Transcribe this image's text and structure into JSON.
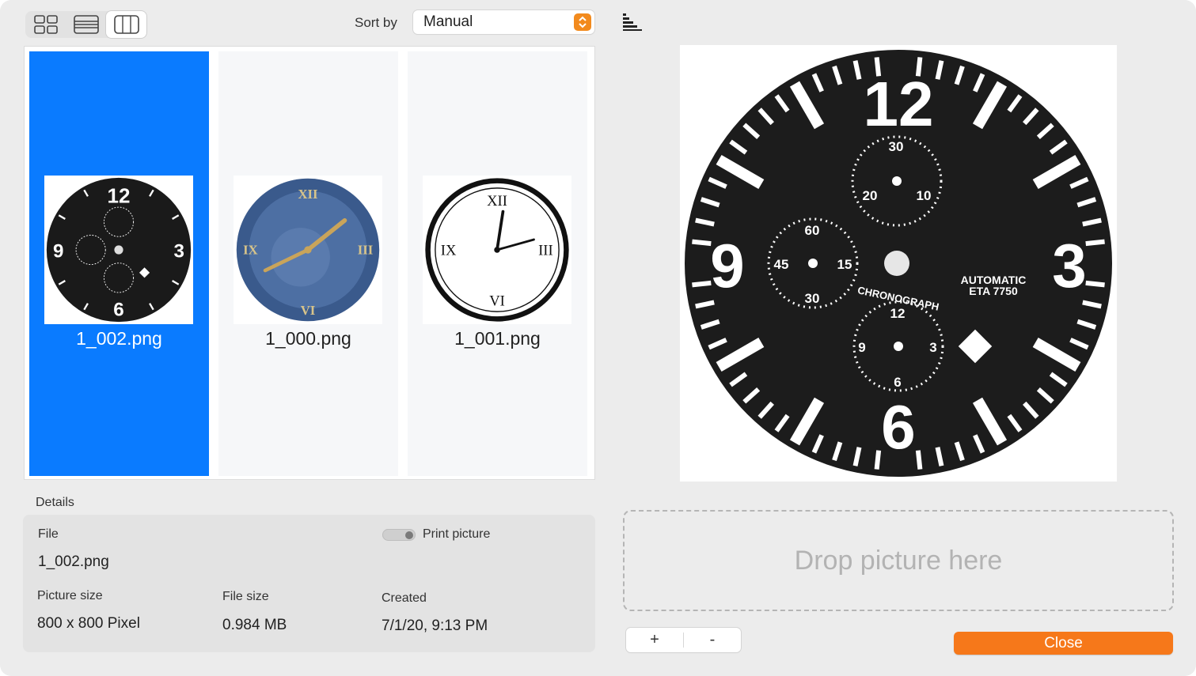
{
  "toolbar": {
    "view_modes": [
      "icon-grid",
      "list",
      "columns"
    ],
    "active_view": "columns",
    "sort_label": "Sort by",
    "sort_value": "Manual"
  },
  "thumbnails": [
    {
      "filename": "1_002.png",
      "selected": true,
      "image": "black chronograph watch dial"
    },
    {
      "filename": "1_000.png",
      "selected": false,
      "image": "blue clock face with gold roman numerals"
    },
    {
      "filename": "1_001.png",
      "selected": false,
      "image": "white clock face with black roman numerals"
    }
  ],
  "details": {
    "title": "Details",
    "file_label": "File",
    "file_value": "1_002.png",
    "print_label": "Print picture",
    "picture_size_label": "Picture size",
    "picture_size_value": "800 x 800 Pixel",
    "file_size_label": "File size",
    "file_size_value": "0.984 MB",
    "created_label": "Created",
    "created_value": "7/1/20, 9:13 PM"
  },
  "preview": {
    "dial_text": {
      "n12": "12",
      "n3": "3",
      "n6": "6",
      "n9": "9",
      "brand1": "AUTOMATIC",
      "brand2": "ETA 7750",
      "chrono": "CHRONOGRAPH",
      "sub_top": [
        "30",
        "20",
        "10"
      ],
      "sub_left": [
        "60",
        "45",
        "15",
        "30"
      ],
      "sub_bottom": [
        "12",
        "9",
        "3",
        "6"
      ]
    }
  },
  "drop_zone": {
    "text": "Drop picture here"
  },
  "buttons": {
    "add": "+",
    "remove": "-",
    "close": "Close"
  },
  "colors": {
    "selection": "#0a7bff",
    "accent": "#f6781a"
  }
}
